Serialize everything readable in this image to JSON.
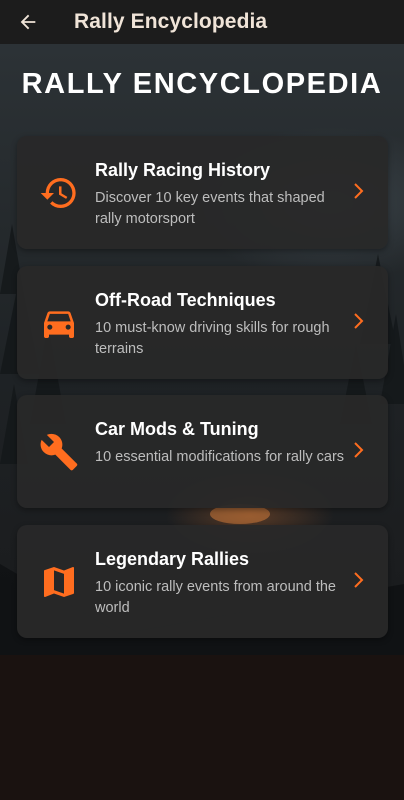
{
  "appbar": {
    "title": "Rally Encyclopedia",
    "back_icon": "arrow-left-icon"
  },
  "main": {
    "heading": "RALLY ENCYCLOPEDIA",
    "cards": [
      {
        "title": "Rally Racing History",
        "description": "Discover 10 key events that shaped rally motorsport",
        "icon": "history-icon"
      },
      {
        "title": "Off-Road Techniques",
        "description": "10 must-know driving skills for rough terrains",
        "icon": "car-icon"
      },
      {
        "title": "Car Mods & Tuning",
        "description": "10 essential modifications for rally cars",
        "icon": "wrench-icon"
      },
      {
        "title": "Legendary Rallies",
        "description": "10 iconic rally events from around the world",
        "icon": "map-icon"
      }
    ]
  },
  "colors": {
    "accent": "#ff6d1f",
    "card_background": "#282828",
    "app_bar": "#1c1c1c",
    "page_background": "#1a1210",
    "title_text": "#f0e4d8"
  }
}
